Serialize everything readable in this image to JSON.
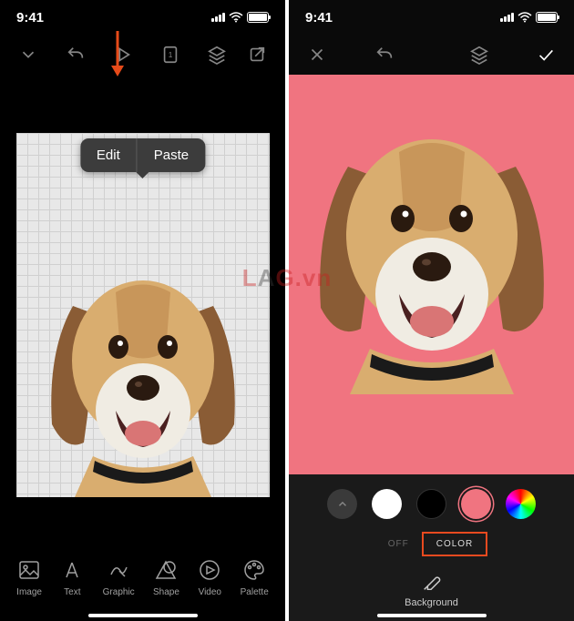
{
  "status": {
    "time": "9:41"
  },
  "popup": {
    "edit": "Edit",
    "paste": "Paste"
  },
  "tools": [
    {
      "name": "image",
      "label": "Image"
    },
    {
      "name": "text",
      "label": "Text"
    },
    {
      "name": "graphic",
      "label": "Graphic"
    },
    {
      "name": "shape",
      "label": "Shape"
    },
    {
      "name": "video",
      "label": "Video"
    },
    {
      "name": "palette",
      "label": "Palette"
    }
  ],
  "right": {
    "toggle": {
      "off": "OFF",
      "color": "COLOR"
    },
    "background_label": "Background",
    "colors": {
      "white": "#ffffff",
      "black": "#000000",
      "pink": "#f07480"
    }
  },
  "watermark": {
    "prefix": "L",
    "mid": "A",
    "suffix": "G.vn"
  }
}
